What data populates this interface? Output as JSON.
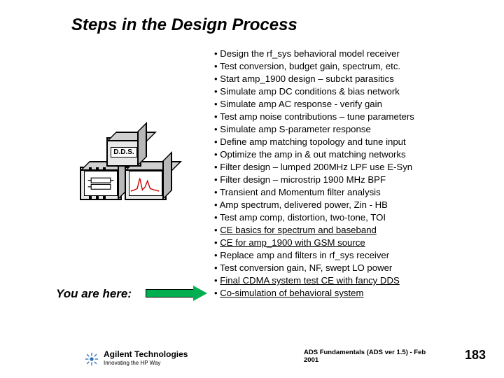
{
  "title": "Steps in the Design Process",
  "graphic": {
    "dds_label": "D.D.S.",
    "icons": {
      "top": "dds-icon",
      "bl": "chip-icon",
      "br": "plot-icon"
    }
  },
  "you_are_here": "You are here:",
  "bullets": [
    {
      "text": "Design the rf_sys behavioral model receiver",
      "u": false
    },
    {
      "text": "Test conversion, budget gain, spectrum, etc.",
      "u": false
    },
    {
      "text": "Start amp_1900 design – subckt parasitics",
      "u": false
    },
    {
      "text": "Simulate amp DC conditions & bias network",
      "u": false
    },
    {
      "text": "Simulate amp AC response - verify gain",
      "u": false
    },
    {
      "text": "Test amp noise contributions – tune parameters",
      "u": false
    },
    {
      "text": "Simulate amp S-parameter response",
      "u": false
    },
    {
      "text": "Define amp matching topology and tune input",
      "u": false
    },
    {
      "text": "Optimize the amp in & out matching networks",
      "u": false
    },
    {
      "text": "Filter design – lumped 200MHz LPF  use E-Syn",
      "u": false
    },
    {
      "text": "Filter design – microstrip 1900 MHz BPF",
      "u": false
    },
    {
      "text": "Transient and Momentum filter analysis",
      "u": false
    },
    {
      "text": "Amp spectrum, delivered power, Zin - HB",
      "u": false
    },
    {
      "text": "Test amp comp, distortion, two-tone, TOI",
      "u": false
    },
    {
      "text": " CE basics for spectrum and baseband",
      "u": true
    },
    {
      "text": "CE for amp_1900 with GSM source",
      "u": true
    },
    {
      "text": "Replace amp and filters in rf_sys receiver",
      "u": false
    },
    {
      "text": "Test conversion gain, NF, swept LO power",
      "u": false
    },
    {
      "text": "Final CDMA system test CE with fancy DDS",
      "u": true
    },
    {
      "text": " Co-simulation of behavioral system",
      "u": true
    }
  ],
  "footer": {
    "logo_company": "Agilent Technologies",
    "logo_tagline": "Innovating the HP Way",
    "note": "ADS Fundamentals (ADS ver 1.5) - Feb 2001",
    "page": "183"
  }
}
